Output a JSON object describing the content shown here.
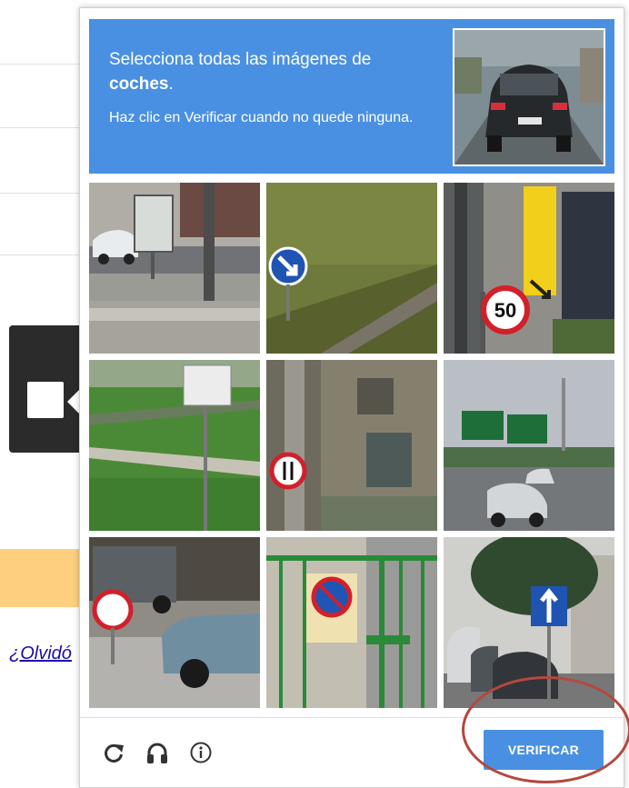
{
  "background": {
    "forgot_link": "¿Olvidó",
    "colors": {
      "orange_band": "#fdcf7f",
      "link": "#1a0dab"
    }
  },
  "captcha": {
    "instruction_prefix": "Selecciona todas las imágenes de",
    "target_object": "coches",
    "target_suffix": ".",
    "instruction_hint": "Haz clic en Verificar cuando no quede ninguna.",
    "verify_label": "VERIFICAR",
    "colors": {
      "header": "#4a90e2",
      "button": "#4a90e2",
      "annotation_circle": "#b5483e"
    },
    "icons": [
      "reload-icon",
      "audio-headphones-icon",
      "info-icon"
    ],
    "tiles": [
      {
        "row": 1,
        "col": 1,
        "content": "highway with white car and sign"
      },
      {
        "row": 1,
        "col": 2,
        "content": "blue arrow road sign on grass"
      },
      {
        "row": 1,
        "col": 3,
        "content": "speed limit 50 sign with bus trailer sign"
      },
      {
        "row": 2,
        "col": 1,
        "content": "sign post on grass"
      },
      {
        "row": 2,
        "col": 2,
        "content": "no passing sign on building"
      },
      {
        "row": 2,
        "col": 3,
        "content": "highway with green signs and cars"
      },
      {
        "row": 3,
        "col": 1,
        "content": "no parking sign with parked cars"
      },
      {
        "row": 3,
        "col": 2,
        "content": "no parking sign on green gate"
      },
      {
        "row": 3,
        "col": 3,
        "content": "one-way sign on street with parked cars"
      }
    ],
    "speed_sign_text": "50"
  }
}
